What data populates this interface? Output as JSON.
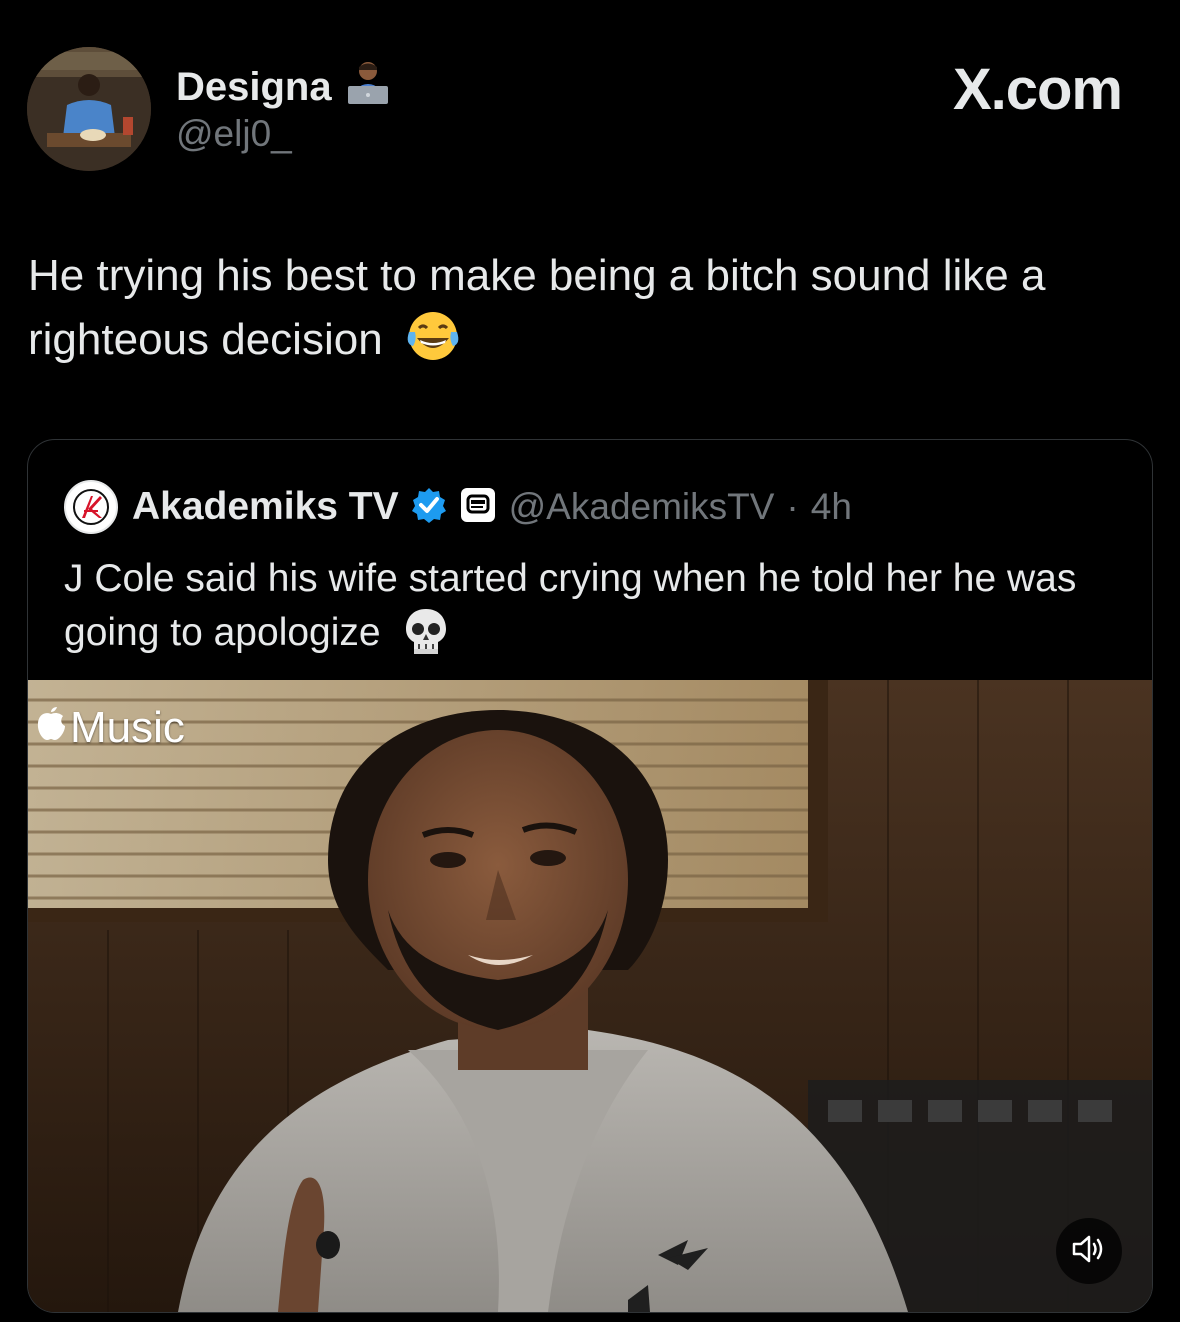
{
  "author": {
    "display_name": "Designa",
    "handle": "@elj0_",
    "name_emoji": "technologist-icon"
  },
  "site_label": "X.com",
  "tweet": {
    "text": "He trying his best to make being a bitch sound like a righteous decision",
    "emoji": "laughing-tears-icon"
  },
  "quote": {
    "display_name": "Akademiks TV",
    "handle": "@AkademiksTV",
    "separator": "·",
    "time": "4h",
    "text": "J Cole said his wife started crying when he told her he was going to apologize",
    "emoji": "skull-icon",
    "verified_color": "#1d9bf0"
  },
  "video": {
    "watermark": "Music",
    "mute_icon": "speaker-icon"
  }
}
